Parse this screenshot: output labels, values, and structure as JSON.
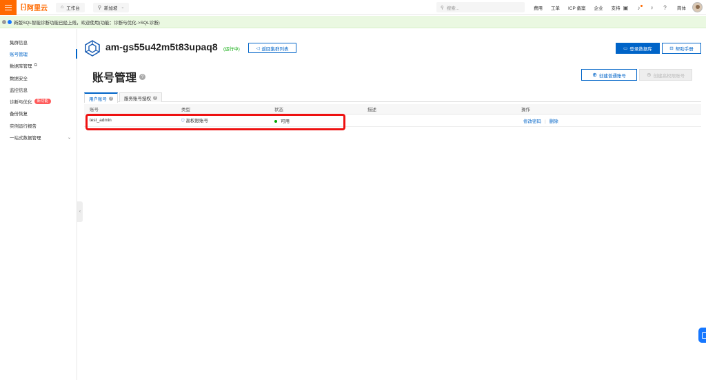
{
  "topbar": {
    "logo_text": "阿里云",
    "logo_mark": "[-]",
    "workbench": "工作台",
    "region": "新加坡",
    "search_placeholder": "搜索...",
    "links": [
      "费用",
      "工单",
      "ICP 备案",
      "企业",
      "支持"
    ],
    "lang": "简体"
  },
  "notice": {
    "text": "新版SQL智能诊断功能已经上线，欢迎使用(功能：诊断与优化->SQL诊断)"
  },
  "sidebar": {
    "items": [
      {
        "label": "集群信息"
      },
      {
        "label": "账号管理"
      },
      {
        "label": "数据库管理"
      },
      {
        "label": "数据安全"
      },
      {
        "label": "监控信息"
      },
      {
        "label": "诊断与优化",
        "badge": "新功能"
      },
      {
        "label": "备份恢复"
      },
      {
        "label": "实例运行报告"
      },
      {
        "label": "一站式数据管理"
      }
    ]
  },
  "instance": {
    "name": "am-gs55u42m5t83upaq8",
    "status": "(运行中)",
    "back_label": "返回集群列表",
    "login_label": "登录数据库",
    "help_label": "帮助手册"
  },
  "page": {
    "title": "账号管理",
    "create_normal": "创建普通账号",
    "create_privileged": "创建高权限账号"
  },
  "tabs": [
    {
      "label": "用户账号"
    },
    {
      "label": "服务账号授权"
    }
  ],
  "table": {
    "columns": [
      "账号",
      "类型",
      "状态",
      "描述",
      "操作"
    ],
    "rows": [
      {
        "account": "test_admin",
        "type": "高权限账号",
        "status": "可用",
        "description": "",
        "actions": [
          "修改密码",
          "删除"
        ]
      }
    ]
  },
  "colors": {
    "brand": "#ff6a00",
    "primary": "#0064c8",
    "success": "#00a700",
    "highlight": "#ee1111"
  }
}
